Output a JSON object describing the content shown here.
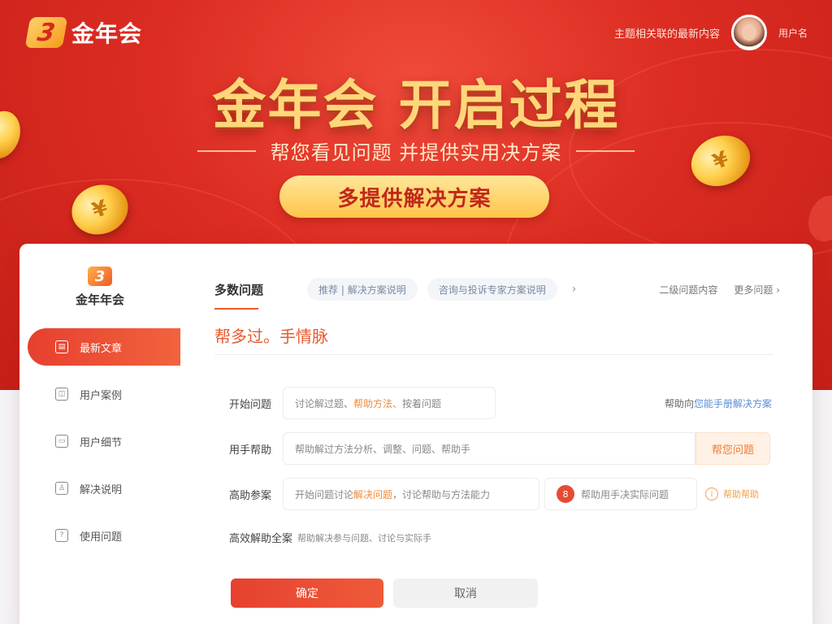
{
  "brand": {
    "logo_glyph": "3",
    "name": "金年会"
  },
  "header": {
    "link": "主题相关联的最新内容",
    "user_name": "用户名"
  },
  "hero": {
    "title": "金年会 开启过程",
    "subtitle": "帮您看见问题 并提供实用决方案",
    "cta_label": "多提供解决方案",
    "coin_glyph": "¥"
  },
  "sidebar": {
    "logo_glyph": "3",
    "logo_text": "金年年会",
    "items": [
      {
        "label": "最新文章",
        "icon": "document-icon",
        "glyph": "▤",
        "active": true
      },
      {
        "label": "用户案例",
        "icon": "case-icon",
        "glyph": "◫",
        "active": false
      },
      {
        "label": "用户细节",
        "icon": "card-icon",
        "glyph": "▭",
        "active": false
      },
      {
        "label": "解决说明",
        "icon": "user-icon",
        "glyph": "♙",
        "active": false
      },
      {
        "label": "使用问题",
        "icon": "chat-icon",
        "glyph": "?",
        "active": false
      }
    ]
  },
  "tabs": {
    "active": "多数问题",
    "pill1": "推荐 | 解决方案说明",
    "pill2": "咨询与投诉专家方案说明",
    "chevron": "›",
    "right1": "二级问题内容",
    "right2": "更多问题 ›"
  },
  "main": {
    "section_title": "帮多过。手情脉",
    "help_prefix": "帮助向",
    "help_link": "您能手册解决方案",
    "rows": [
      {
        "label": "开始问题",
        "value_plain": "讨论解过题、",
        "value_highlight": "帮助方法、",
        "value_tail": "按着问题"
      },
      {
        "label": "用手帮助",
        "value": "帮助解过方法分析、调整、问题、帮助手",
        "button": "帮您问题"
      },
      {
        "label": "高助参案",
        "value_plain": "开始问题讨论",
        "value_highlight": "解决问题",
        "value_tail": "，讨论帮助与方法能力",
        "badge": "8",
        "badge_text": "帮助用手决实际问题",
        "info_text": "帮助帮助"
      },
      {
        "label": "高效解助全案",
        "value": "帮助解决参与问题、讨论与实际手"
      }
    ],
    "primary_button": "确定",
    "secondary_button": "取消"
  },
  "colors": {
    "hero_red": "#dc2c22",
    "gold": "#ffd77a",
    "accent_orange": "#ef5a25",
    "link_blue": "#5b8ed6"
  }
}
